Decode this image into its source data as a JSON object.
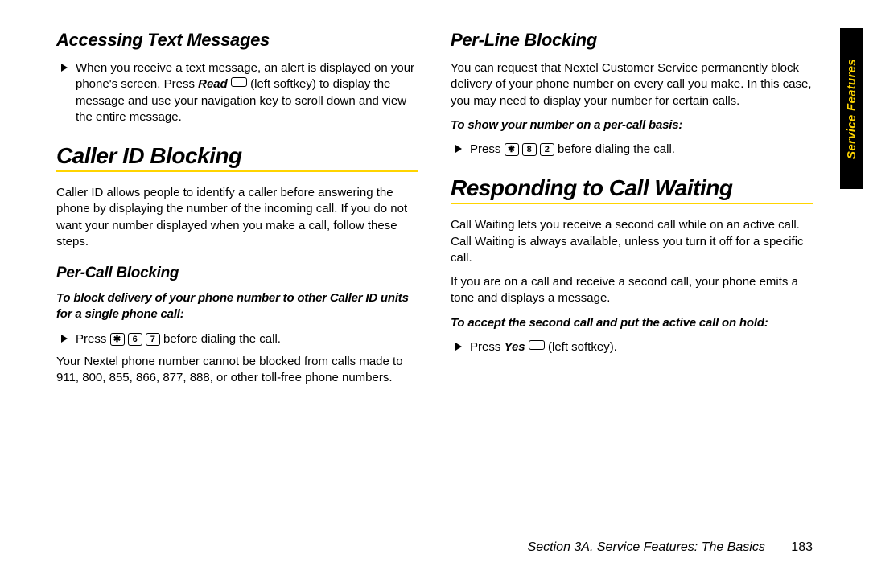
{
  "left": {
    "h_access": "Accessing Text Messages",
    "access_bullet_pre": "When you receive a text message, an alert is displayed on your phone's screen. Press ",
    "access_bullet_bold": "Read",
    "access_bullet_post": " (left softkey) to display the message and use your navigation key to scroll down and view the entire message.",
    "h_caller": "Caller ID Blocking",
    "caller_para": "Caller ID allows people to identify a caller before answering the phone by displaying the number of the incoming call. If you do not want your number displayed when you make a call, follow these steps.",
    "h_percall": "Per-Call Blocking",
    "percall_instr": "To block delivery of your phone number to other Caller ID units for a single phone call:",
    "percall_press_pre": "Press ",
    "percall_key1": "✱",
    "percall_key2": "6",
    "percall_key3": "7",
    "percall_press_post": " before dialing the call.",
    "percall_note": "Your Nextel phone number cannot be blocked from calls made to 911, 800, 855, 866, 877, 888, or other toll-free phone numbers."
  },
  "right": {
    "h_perline": "Per-Line Blocking",
    "perline_para": "You can request that Nextel Customer Service permanently block delivery of your phone number on every call you make.  In this case, you may need to display your number for certain calls.",
    "perline_instr": "To show your number on a per-call basis:",
    "perline_press_pre": "Press ",
    "perline_key1": "✱",
    "perline_key2": "8",
    "perline_key3": "2",
    "perline_press_post": " before dialing the call.",
    "h_respond": "Responding to Call Waiting",
    "respond_para1": "Call Waiting lets you receive a second call while on an active call. Call Waiting is always available, unless you turn it off for a specific call.",
    "respond_para2": "If you are on a call and receive a second call, your phone emits a tone and displays a message.",
    "respond_instr": "To accept the second call and put the active call on hold:",
    "respond_press_pre": "Press ",
    "respond_press_bold": "Yes",
    "respond_press_post": " (left softkey)."
  },
  "side_tab": "Service Features",
  "footer_section": "Section 3A. Service Features: The Basics",
  "page_number": "183"
}
